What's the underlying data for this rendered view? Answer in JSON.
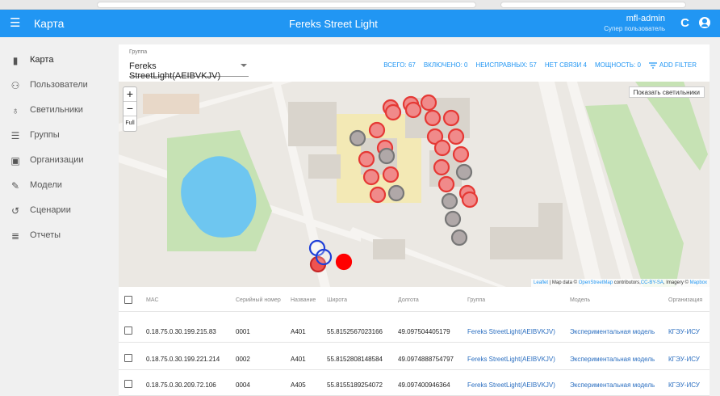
{
  "appbar": {
    "menu_icon": "menu-icon",
    "title": "Карта",
    "center_title": "Fereks Street Light",
    "user_name": "mfl-admin",
    "user_role": "Супер пользователь",
    "refresh_icon": "refresh-icon",
    "account_icon": "account-icon",
    "color": "#2196f3"
  },
  "sidebar": {
    "items": [
      {
        "label": "Карта",
        "icon": "map-icon",
        "glyph": "▮"
      },
      {
        "label": "Пользователи",
        "icon": "users-icon",
        "glyph": "👥"
      },
      {
        "label": "Светильники",
        "icon": "lightbulb-icon",
        "glyph": "💡"
      },
      {
        "label": "Группы",
        "icon": "list-icon",
        "glyph": "☰"
      },
      {
        "label": "Организации",
        "icon": "briefcase-icon",
        "glyph": "💼"
      },
      {
        "label": "Модели",
        "icon": "wrench-icon",
        "glyph": "🔧"
      },
      {
        "label": "Сценарии",
        "icon": "history-icon",
        "glyph": "↺"
      },
      {
        "label": "Отчеты",
        "icon": "report-icon",
        "glyph": "≣"
      }
    ]
  },
  "group": {
    "caption": "Группа",
    "value": "Fereks StreetLight(AEIBVKJV)"
  },
  "stats": {
    "total": "ВСЕГО: 67",
    "on": "ВКЛЮЧЕНО: 0",
    "faulty": "НЕИСПРАВНЫХ: 57",
    "no_link": "НЕТ СВЯЗИ 4",
    "power": "МОЩНОСТЬ: 0",
    "add_filter": "ADD FILTER"
  },
  "map": {
    "zoom_in": "+",
    "zoom_out": "−",
    "full": "Full",
    "show_lamps": "Показать светильники",
    "attribution_leaflet": "Leaflet",
    "attribution_text": " | Map data © ",
    "attribution_osm": "OpenStreetMap",
    "attribution_text2": " contributors,",
    "attribution_cc": "CC-BY-SA",
    "attribution_text3": ", Imagery © ",
    "attribution_mapbox": "Mapbox",
    "colors": {
      "faulty": "#e53935",
      "grey": "#9e9e9e",
      "offline": "#1e3fd8",
      "active": "#ff0000",
      "water": "#6ec6f0",
      "park": "#c8e6b8",
      "building": "#d9d4cc",
      "campus": "#f3e9b5"
    }
  },
  "table": {
    "headers": [
      "MAC",
      "Серийный номер",
      "Название",
      "Широта",
      "Долгота",
      "Группа",
      "Модель",
      "Организация"
    ],
    "rows": [
      [
        "0.18.75.0.30.199.215.83",
        "0001",
        "A401",
        "55.8152567023166",
        "49.097504405179",
        "Fereks StreetLight(AEIBVKJV)",
        "Экспериментальная модель",
        "КГЭУ-ИСУ"
      ],
      [
        "0.18.75.0.30.199.221.214",
        "0002",
        "A401",
        "55.8152808148584",
        "49.0974888754797",
        "Fereks StreetLight(AEIBVKJV)",
        "Экспериментальная модель",
        "КГЭУ-ИСУ"
      ],
      [
        "0.18.75.0.30.209.72.106",
        "0004",
        "A405",
        "55.8155189254072",
        "49.097400946364",
        "Fereks StreetLight(AEIBVKJV)",
        "Экспериментальная модель",
        "КГЭУ-ИСУ"
      ]
    ]
  }
}
